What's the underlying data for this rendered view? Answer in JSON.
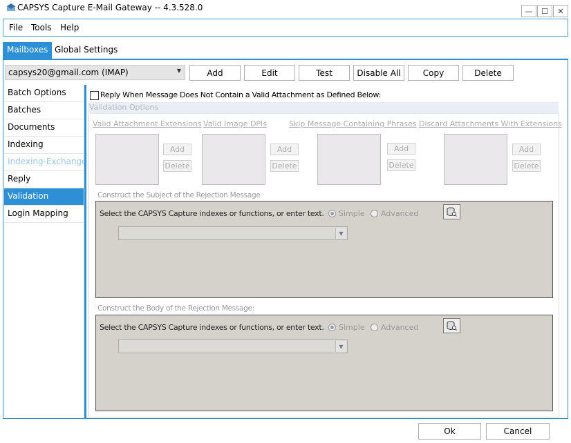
{
  "window": {
    "title": "CAPSYS Capture E-Mail Gateway -- 4.3.528.0",
    "icon": "envelope-icon",
    "controls": {
      "minimize": "—",
      "maximize": "☐",
      "close": "✕"
    }
  },
  "menu": [
    "File",
    "Tools",
    "Help"
  ],
  "tabs": [
    {
      "label": "Mailboxes",
      "active": true
    },
    {
      "label": "Global Settings",
      "active": false
    }
  ],
  "mailbox": {
    "selected": "capsys20@gmail.com (IMAP)"
  },
  "toolbar": [
    "Add",
    "Edit",
    "Test",
    "Disable All",
    "Copy",
    "Delete"
  ],
  "sidebar": [
    {
      "label": "Batch Options",
      "state": "normal"
    },
    {
      "label": "Batches",
      "state": "normal"
    },
    {
      "label": "Documents",
      "state": "normal"
    },
    {
      "label": "Indexing",
      "state": "normal"
    },
    {
      "label": "Indexing-Exchange",
      "state": "disabled"
    },
    {
      "label": "Reply",
      "state": "normal"
    },
    {
      "label": "Validation",
      "state": "active"
    },
    {
      "label": "Login Mapping",
      "state": "normal"
    }
  ],
  "validation": {
    "reply_checkbox_label": "Reply When Message Does Not Contain a Valid Attachment as Defined Below:",
    "reply_checked": false,
    "section_title": "Validation Options",
    "lists": [
      {
        "label": "Valid Attachment Extensions",
        "add": "Add",
        "delete": "Delete"
      },
      {
        "label": "Valid Image DPIs",
        "add": "Add",
        "delete": "Delete"
      },
      {
        "label": "Skip Message Containing Phrases",
        "add": "Add",
        "delete": "Delete"
      },
      {
        "label": "Discard Attachments With Extensions",
        "add": "Add",
        "delete": "Delete"
      }
    ],
    "subject": {
      "group_label": "Construct the Subject of the Rejection Message",
      "instruction": "Select the CAPSYS Capture indexes or functions, or enter text.",
      "simple": "Simple",
      "advanced": "Advanced",
      "mode": "Simple",
      "dropdown_value": ""
    },
    "body": {
      "group_label": "Construct the Body of the Rejection Message:",
      "instruction": "Select the CAPSYS Capture indexes or functions, or enter text.",
      "simple": "Simple",
      "advanced": "Advanced",
      "mode": "Simple",
      "dropdown_value": ""
    }
  },
  "footer": {
    "ok": "Ok",
    "cancel": "Cancel"
  },
  "colors": {
    "accent": "#2d8fd5",
    "group_bg": "#d5d2cc",
    "list_bg": "#ebe8eb",
    "disabled_text": "#adadad"
  }
}
